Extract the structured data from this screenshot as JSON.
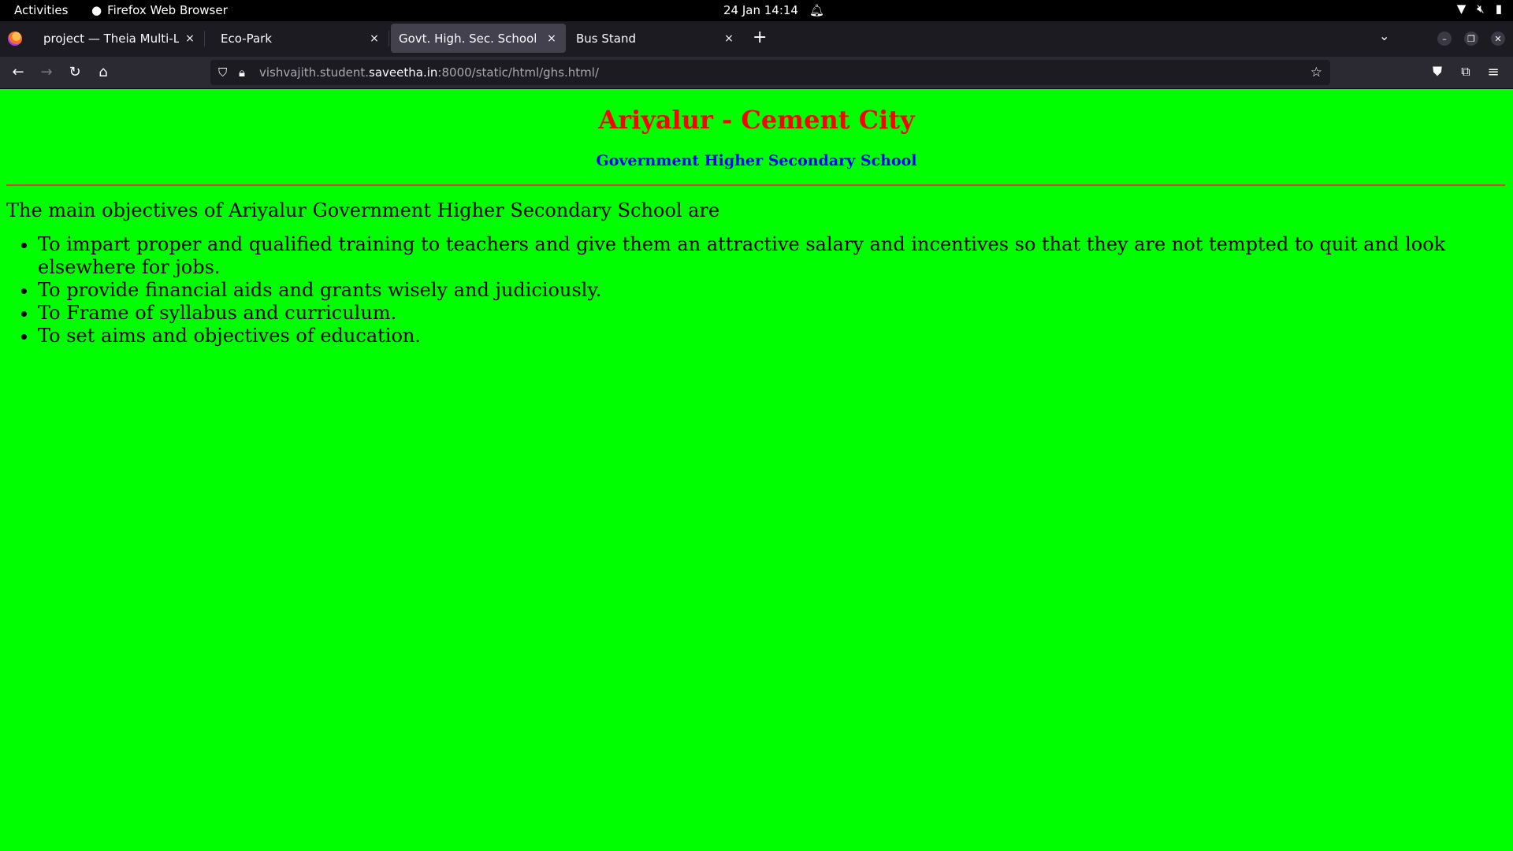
{
  "system_bar": {
    "activities": "Activities",
    "app_name": "Firefox Web Browser",
    "datetime": "24 Jan  14:14"
  },
  "tabs": [
    {
      "label": "project — Theia Multi-Langu",
      "active": false
    },
    {
      "label": "Eco-Park",
      "active": false
    },
    {
      "label": "Govt. High. Sec. School",
      "active": true
    },
    {
      "label": "Bus Stand",
      "active": false
    }
  ],
  "url": {
    "prefix": "vishvajith.student.",
    "host": "saveetha.in",
    "suffix": ":8000/static/html/ghs.html/"
  },
  "page": {
    "title": "Ariyalur - Cement City",
    "subtitle": "Government Higher Secondary School",
    "intro": "The main objectives of Ariyalur Government Higher Secondary School are",
    "objectives": [
      "To impart proper and qualified training to teachers and give them an attractive salary and incentives so that they are not tempted to quit and look elsewhere for jobs.",
      "To provide financial aids and grants wisely and judiciously.",
      "To Frame of syllabus and curriculum.",
      "To set aims and objectives of education."
    ]
  },
  "colors": {
    "page_background": "#00ff00",
    "title": "#ff0000",
    "subtitle": "#0000ff",
    "rule": "#d84038"
  },
  "icons": {
    "tab_close": "×",
    "new_tab": "+",
    "back": "←",
    "forward": "→",
    "reload": "↻",
    "home": "⌂",
    "bookmark_star": "☆",
    "menu": "≡"
  }
}
